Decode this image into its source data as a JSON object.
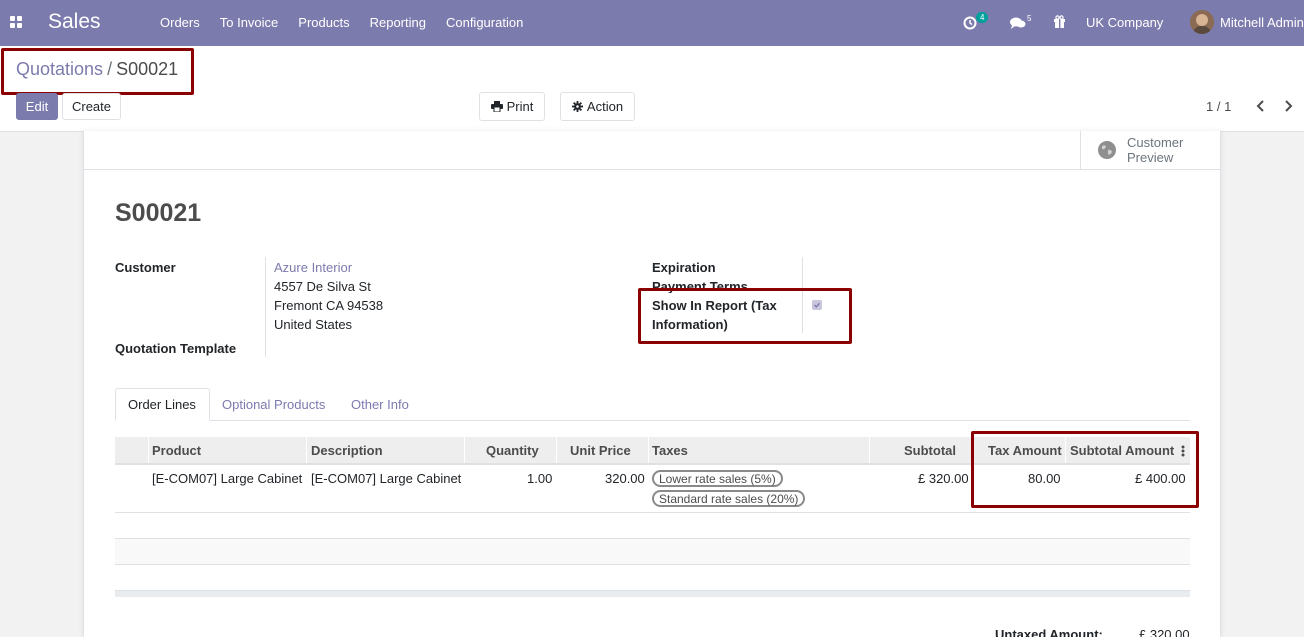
{
  "navbar": {
    "app_name": "Sales",
    "menu": [
      "Orders",
      "To Invoice",
      "Products",
      "Reporting",
      "Configuration"
    ],
    "activity_count": "4",
    "message_count": "5",
    "company": "UK Company",
    "user": "Mitchell Admin"
  },
  "breadcrumb": {
    "parent": "Quotations",
    "separator": "/",
    "current": "S00021"
  },
  "toolbar": {
    "edit_label": "Edit",
    "create_label": "Create",
    "print_label": "Print",
    "action_label": "Action"
  },
  "pager": {
    "value": "1 / 1"
  },
  "statusbar": {
    "customer_preview_line1": "Customer",
    "customer_preview_line2": "Preview"
  },
  "form": {
    "title": "S00021",
    "customer_label": "Customer",
    "customer_name": "Azure Interior",
    "address_line1": "4557 De Silva St",
    "address_line2": "Fremont CA 94538",
    "address_line3": "United States",
    "template_label": "Quotation Template",
    "expiration_label": "Expiration",
    "payment_terms_label": "Payment Terms",
    "show_in_report_label_1": "Show In Report (Tax",
    "show_in_report_label_2": "Information)",
    "show_in_report_checked": true
  },
  "tabs": [
    "Order Lines",
    "Optional Products",
    "Other Info"
  ],
  "table": {
    "headers": [
      "Product",
      "Description",
      "Quantity",
      "Unit Price",
      "Taxes",
      "Subtotal",
      "Tax Amount",
      "Subtotal Amount"
    ],
    "rows": [
      {
        "product": "[E-COM07] Large Cabinet",
        "description": "[E-COM07] Large Cabinet",
        "quantity": "1.00",
        "unit_price": "320.00",
        "taxes": [
          "Lower rate sales (5%)",
          "Standard rate sales (20%)"
        ],
        "subtotal": "£ 320.00",
        "tax_amount": "80.00",
        "subtotal_amount": "£ 400.00"
      }
    ]
  },
  "totals": {
    "untaxed_label": "Untaxed Amount:",
    "untaxed_value": "£ 320.00"
  },
  "colors": {
    "brand": "#7c7bad",
    "highlight": "#8b0000"
  }
}
